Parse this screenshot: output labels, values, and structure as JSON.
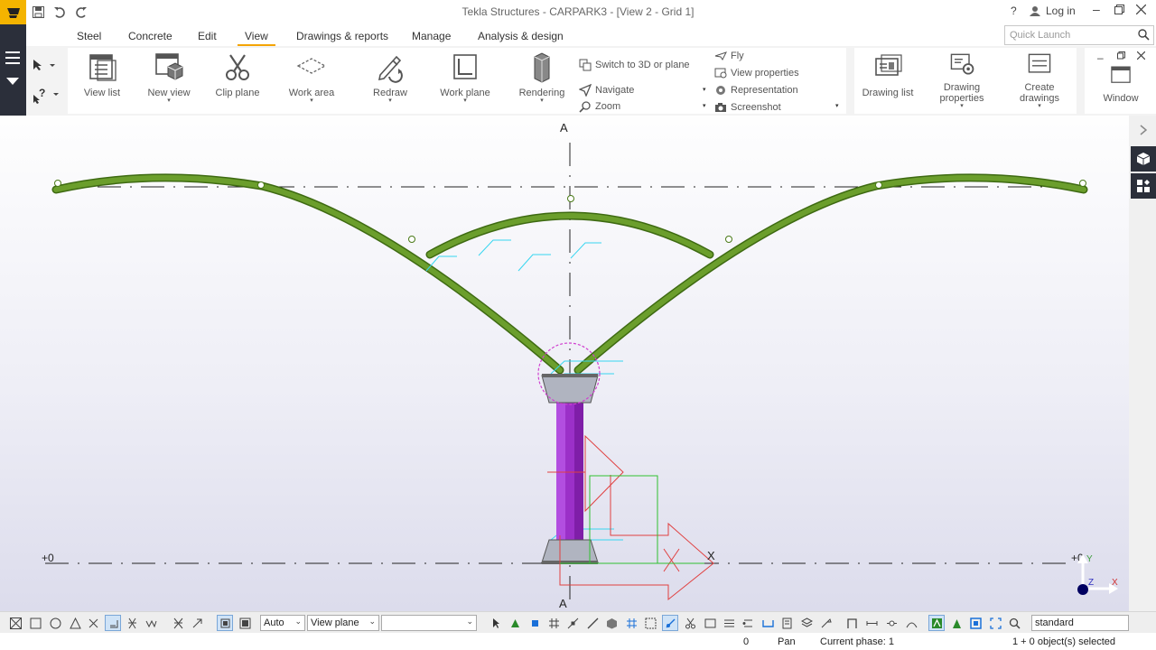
{
  "title_bar": {
    "title": "Tekla Structures - CARPARK3 - [View 2 - Grid 1]",
    "help": "?",
    "login": "Log in"
  },
  "tabs": [
    "Steel",
    "Concrete",
    "Edit",
    "View",
    "Drawings & reports",
    "Manage",
    "Analysis & design"
  ],
  "active_tab": "View",
  "quick_launch": {
    "placeholder": "Quick Launch"
  },
  "ribbon": {
    "view_list": "View list",
    "new_view": "New view",
    "clip_plane": "Clip plane",
    "work_area": "Work area",
    "redraw": "Redraw",
    "work_plane": "Work plane",
    "rendering": "Rendering",
    "switch_3d": "Switch to 3D or plane",
    "navigate": "Navigate",
    "zoom": "Zoom",
    "fly": "Fly",
    "view_properties": "View properties",
    "representation": "Representation",
    "screenshot": "Screenshot",
    "drawing_list": "Drawing list",
    "drawing_properties_1": "Drawing",
    "drawing_properties_2": "properties",
    "create_drawings_1": "Create",
    "create_drawings_2": "drawings",
    "window": "Window"
  },
  "model": {
    "section_label": "A",
    "level_label": "+0",
    "level_label_right": "+0",
    "axis_x": "X",
    "axis_y": "Y",
    "axis_z": "Z"
  },
  "toolbar": {
    "auto_select": "Auto",
    "plane_select": "View plane",
    "empty_select": "",
    "standard_field": "standard"
  },
  "status": {
    "count": "0",
    "mode": "Pan",
    "phase": "Current phase: 1",
    "selection": "1 + 0 object(s) selected"
  },
  "colors": {
    "accent": "#f4b400",
    "beam": "#5e8f24",
    "column": "#9b30c8",
    "dark_panel": "#2b2f3a"
  }
}
